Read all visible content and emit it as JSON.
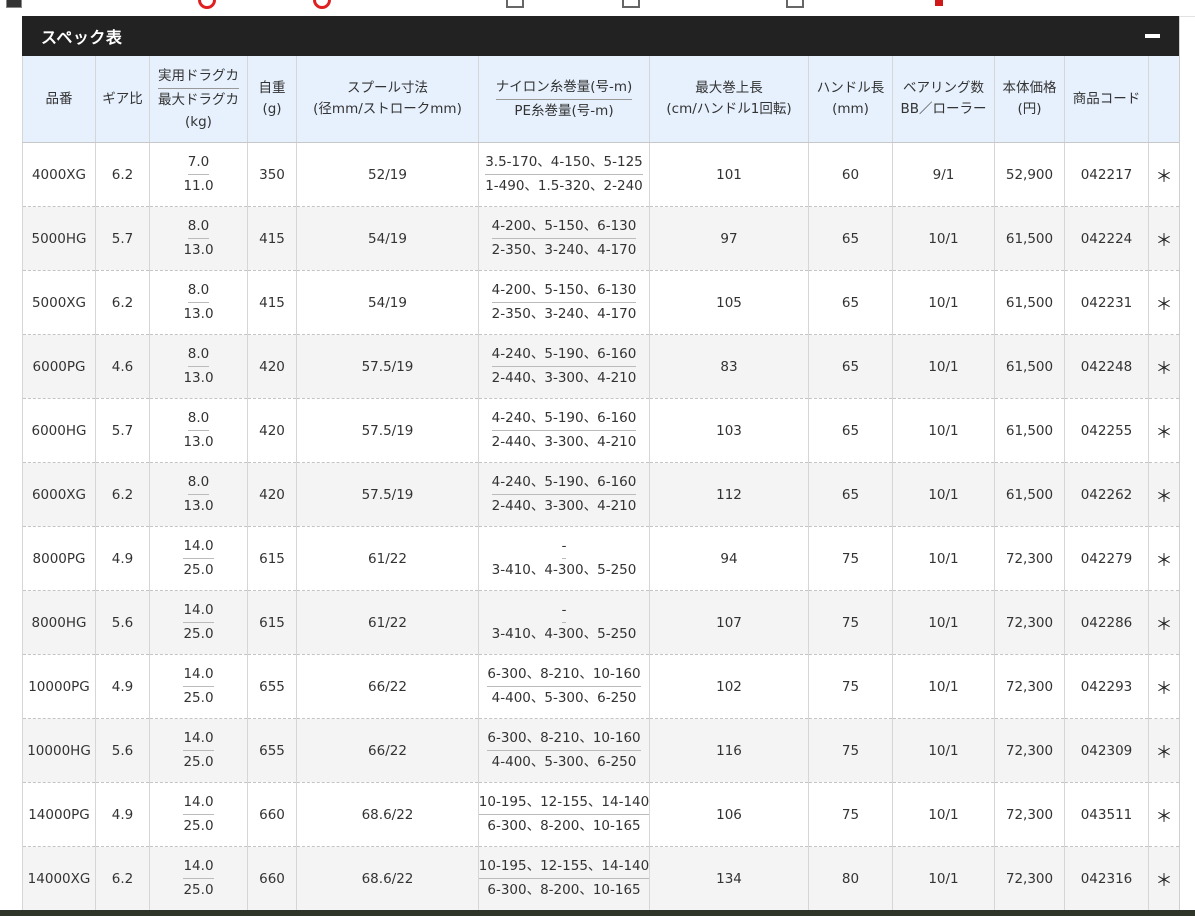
{
  "panel": {
    "title": "スペック表"
  },
  "table": {
    "headers": {
      "model": "品番",
      "gear": "ギア比",
      "drag_top": "実用ドラグカ",
      "drag_bot": "最大ドラグカ",
      "drag_unit": "(kg)",
      "weight": "自重",
      "weight_unit": "(g)",
      "spool": "スプール寸法",
      "spool_unit": "(径mm/ストロークmm)",
      "line_top": "ナイロン糸巻量(号-m)",
      "line_bot": "PE糸巻量(号-m)",
      "retrieve": "最大巻上長",
      "retrieve_unit": "(cm/ハンドル1回転)",
      "handle": "ハンドル長",
      "handle_unit": "(mm)",
      "bearing": "ベアリング数",
      "bearing_unit": "BB／ローラー",
      "price": "本体価格",
      "price_unit": "(円)",
      "code": "商品コード",
      "extra": ""
    },
    "rows": [
      {
        "model": "4000XG",
        "gear": "6.2",
        "drag_top": "7.0",
        "drag_bot": "11.0",
        "weight": "350",
        "spool": "52/19",
        "line_top": "3.5-170、4-150、5-125",
        "line_bot": "1-490、1.5-320、2-240",
        "retrieve": "101",
        "handle": "60",
        "bearing": "9/1",
        "price": "52,900",
        "code": "042217",
        "extra": "＊"
      },
      {
        "model": "5000HG",
        "gear": "5.7",
        "drag_top": "8.0",
        "drag_bot": "13.0",
        "weight": "415",
        "spool": "54/19",
        "line_top": "4-200、5-150、6-130",
        "line_bot": "2-350、3-240、4-170",
        "retrieve": "97",
        "handle": "65",
        "bearing": "10/1",
        "price": "61,500",
        "code": "042224",
        "extra": "＊"
      },
      {
        "model": "5000XG",
        "gear": "6.2",
        "drag_top": "8.0",
        "drag_bot": "13.0",
        "weight": "415",
        "spool": "54/19",
        "line_top": "4-200、5-150、6-130",
        "line_bot": "2-350、3-240、4-170",
        "retrieve": "105",
        "handle": "65",
        "bearing": "10/1",
        "price": "61,500",
        "code": "042231",
        "extra": "＊"
      },
      {
        "model": "6000PG",
        "gear": "4.6",
        "drag_top": "8.0",
        "drag_bot": "13.0",
        "weight": "420",
        "spool": "57.5/19",
        "line_top": "4-240、5-190、6-160",
        "line_bot": "2-440、3-300、4-210",
        "retrieve": "83",
        "handle": "65",
        "bearing": "10/1",
        "price": "61,500",
        "code": "042248",
        "extra": "＊"
      },
      {
        "model": "6000HG",
        "gear": "5.7",
        "drag_top": "8.0",
        "drag_bot": "13.0",
        "weight": "420",
        "spool": "57.5/19",
        "line_top": "4-240、5-190、6-160",
        "line_bot": "2-440、3-300、4-210",
        "retrieve": "103",
        "handle": "65",
        "bearing": "10/1",
        "price": "61,500",
        "code": "042255",
        "extra": "＊"
      },
      {
        "model": "6000XG",
        "gear": "6.2",
        "drag_top": "8.0",
        "drag_bot": "13.0",
        "weight": "420",
        "spool": "57.5/19",
        "line_top": "4-240、5-190、6-160",
        "line_bot": "2-440、3-300、4-210",
        "retrieve": "112",
        "handle": "65",
        "bearing": "10/1",
        "price": "61,500",
        "code": "042262",
        "extra": "＊"
      },
      {
        "model": "8000PG",
        "gear": "4.9",
        "drag_top": "14.0",
        "drag_bot": "25.0",
        "weight": "615",
        "spool": "61/22",
        "line_top": "-",
        "line_bot": "3-410、4-300、5-250",
        "retrieve": "94",
        "handle": "75",
        "bearing": "10/1",
        "price": "72,300",
        "code": "042279",
        "extra": "＊"
      },
      {
        "model": "8000HG",
        "gear": "5.6",
        "drag_top": "14.0",
        "drag_bot": "25.0",
        "weight": "615",
        "spool": "61/22",
        "line_top": "-",
        "line_bot": "3-410、4-300、5-250",
        "retrieve": "107",
        "handle": "75",
        "bearing": "10/1",
        "price": "72,300",
        "code": "042286",
        "extra": "＊"
      },
      {
        "model": "10000PG",
        "gear": "4.9",
        "drag_top": "14.0",
        "drag_bot": "25.0",
        "weight": "655",
        "spool": "66/22",
        "line_top": "6-300、8-210、10-160",
        "line_bot": "4-400、5-300、6-250",
        "retrieve": "102",
        "handle": "75",
        "bearing": "10/1",
        "price": "72,300",
        "code": "042293",
        "extra": "＊"
      },
      {
        "model": "10000HG",
        "gear": "5.6",
        "drag_top": "14.0",
        "drag_bot": "25.0",
        "weight": "655",
        "spool": "66/22",
        "line_top": "6-300、8-210、10-160",
        "line_bot": "4-400、5-300、6-250",
        "retrieve": "116",
        "handle": "75",
        "bearing": "10/1",
        "price": "72,300",
        "code": "042309",
        "extra": "＊"
      },
      {
        "model": "14000PG",
        "gear": "4.9",
        "drag_top": "14.0",
        "drag_bot": "25.0",
        "weight": "660",
        "spool": "68.6/22",
        "line_top": "10-195、12-155、14-140",
        "line_bot": "6-300、8-200、10-165",
        "retrieve": "106",
        "handle": "75",
        "bearing": "10/1",
        "price": "72,300",
        "code": "043511",
        "extra": "＊"
      },
      {
        "model": "14000XG",
        "gear": "6.2",
        "drag_top": "14.0",
        "drag_bot": "25.0",
        "weight": "660",
        "spool": "68.6/22",
        "line_top": "10-195、12-155、14-140",
        "line_bot": "6-300、8-200、10-165",
        "retrieve": "134",
        "handle": "80",
        "bearing": "10/1",
        "price": "72,300",
        "code": "042316",
        "extra": "＊"
      }
    ]
  }
}
